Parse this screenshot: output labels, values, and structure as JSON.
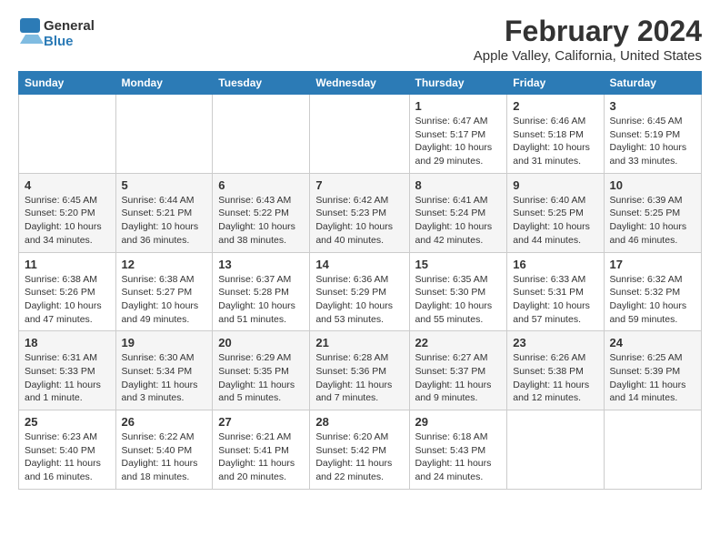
{
  "header": {
    "logo_line1": "General",
    "logo_line2": "Blue",
    "title": "February 2024",
    "subtitle": "Apple Valley, California, United States"
  },
  "days_of_week": [
    "Sunday",
    "Monday",
    "Tuesday",
    "Wednesday",
    "Thursday",
    "Friday",
    "Saturday"
  ],
  "weeks": [
    [
      {
        "day": "",
        "detail": ""
      },
      {
        "day": "",
        "detail": ""
      },
      {
        "day": "",
        "detail": ""
      },
      {
        "day": "",
        "detail": ""
      },
      {
        "day": "1",
        "detail": "Sunrise: 6:47 AM\nSunset: 5:17 PM\nDaylight: 10 hours\nand 29 minutes."
      },
      {
        "day": "2",
        "detail": "Sunrise: 6:46 AM\nSunset: 5:18 PM\nDaylight: 10 hours\nand 31 minutes."
      },
      {
        "day": "3",
        "detail": "Sunrise: 6:45 AM\nSunset: 5:19 PM\nDaylight: 10 hours\nand 33 minutes."
      }
    ],
    [
      {
        "day": "4",
        "detail": "Sunrise: 6:45 AM\nSunset: 5:20 PM\nDaylight: 10 hours\nand 34 minutes."
      },
      {
        "day": "5",
        "detail": "Sunrise: 6:44 AM\nSunset: 5:21 PM\nDaylight: 10 hours\nand 36 minutes."
      },
      {
        "day": "6",
        "detail": "Sunrise: 6:43 AM\nSunset: 5:22 PM\nDaylight: 10 hours\nand 38 minutes."
      },
      {
        "day": "7",
        "detail": "Sunrise: 6:42 AM\nSunset: 5:23 PM\nDaylight: 10 hours\nand 40 minutes."
      },
      {
        "day": "8",
        "detail": "Sunrise: 6:41 AM\nSunset: 5:24 PM\nDaylight: 10 hours\nand 42 minutes."
      },
      {
        "day": "9",
        "detail": "Sunrise: 6:40 AM\nSunset: 5:25 PM\nDaylight: 10 hours\nand 44 minutes."
      },
      {
        "day": "10",
        "detail": "Sunrise: 6:39 AM\nSunset: 5:25 PM\nDaylight: 10 hours\nand 46 minutes."
      }
    ],
    [
      {
        "day": "11",
        "detail": "Sunrise: 6:38 AM\nSunset: 5:26 PM\nDaylight: 10 hours\nand 47 minutes."
      },
      {
        "day": "12",
        "detail": "Sunrise: 6:38 AM\nSunset: 5:27 PM\nDaylight: 10 hours\nand 49 minutes."
      },
      {
        "day": "13",
        "detail": "Sunrise: 6:37 AM\nSunset: 5:28 PM\nDaylight: 10 hours\nand 51 minutes."
      },
      {
        "day": "14",
        "detail": "Sunrise: 6:36 AM\nSunset: 5:29 PM\nDaylight: 10 hours\nand 53 minutes."
      },
      {
        "day": "15",
        "detail": "Sunrise: 6:35 AM\nSunset: 5:30 PM\nDaylight: 10 hours\nand 55 minutes."
      },
      {
        "day": "16",
        "detail": "Sunrise: 6:33 AM\nSunset: 5:31 PM\nDaylight: 10 hours\nand 57 minutes."
      },
      {
        "day": "17",
        "detail": "Sunrise: 6:32 AM\nSunset: 5:32 PM\nDaylight: 10 hours\nand 59 minutes."
      }
    ],
    [
      {
        "day": "18",
        "detail": "Sunrise: 6:31 AM\nSunset: 5:33 PM\nDaylight: 11 hours\nand 1 minute."
      },
      {
        "day": "19",
        "detail": "Sunrise: 6:30 AM\nSunset: 5:34 PM\nDaylight: 11 hours\nand 3 minutes."
      },
      {
        "day": "20",
        "detail": "Sunrise: 6:29 AM\nSunset: 5:35 PM\nDaylight: 11 hours\nand 5 minutes."
      },
      {
        "day": "21",
        "detail": "Sunrise: 6:28 AM\nSunset: 5:36 PM\nDaylight: 11 hours\nand 7 minutes."
      },
      {
        "day": "22",
        "detail": "Sunrise: 6:27 AM\nSunset: 5:37 PM\nDaylight: 11 hours\nand 9 minutes."
      },
      {
        "day": "23",
        "detail": "Sunrise: 6:26 AM\nSunset: 5:38 PM\nDaylight: 11 hours\nand 12 minutes."
      },
      {
        "day": "24",
        "detail": "Sunrise: 6:25 AM\nSunset: 5:39 PM\nDaylight: 11 hours\nand 14 minutes."
      }
    ],
    [
      {
        "day": "25",
        "detail": "Sunrise: 6:23 AM\nSunset: 5:40 PM\nDaylight: 11 hours\nand 16 minutes."
      },
      {
        "day": "26",
        "detail": "Sunrise: 6:22 AM\nSunset: 5:40 PM\nDaylight: 11 hours\nand 18 minutes."
      },
      {
        "day": "27",
        "detail": "Sunrise: 6:21 AM\nSunset: 5:41 PM\nDaylight: 11 hours\nand 20 minutes."
      },
      {
        "day": "28",
        "detail": "Sunrise: 6:20 AM\nSunset: 5:42 PM\nDaylight: 11 hours\nand 22 minutes."
      },
      {
        "day": "29",
        "detail": "Sunrise: 6:18 AM\nSunset: 5:43 PM\nDaylight: 11 hours\nand 24 minutes."
      },
      {
        "day": "",
        "detail": ""
      },
      {
        "day": "",
        "detail": ""
      }
    ]
  ]
}
